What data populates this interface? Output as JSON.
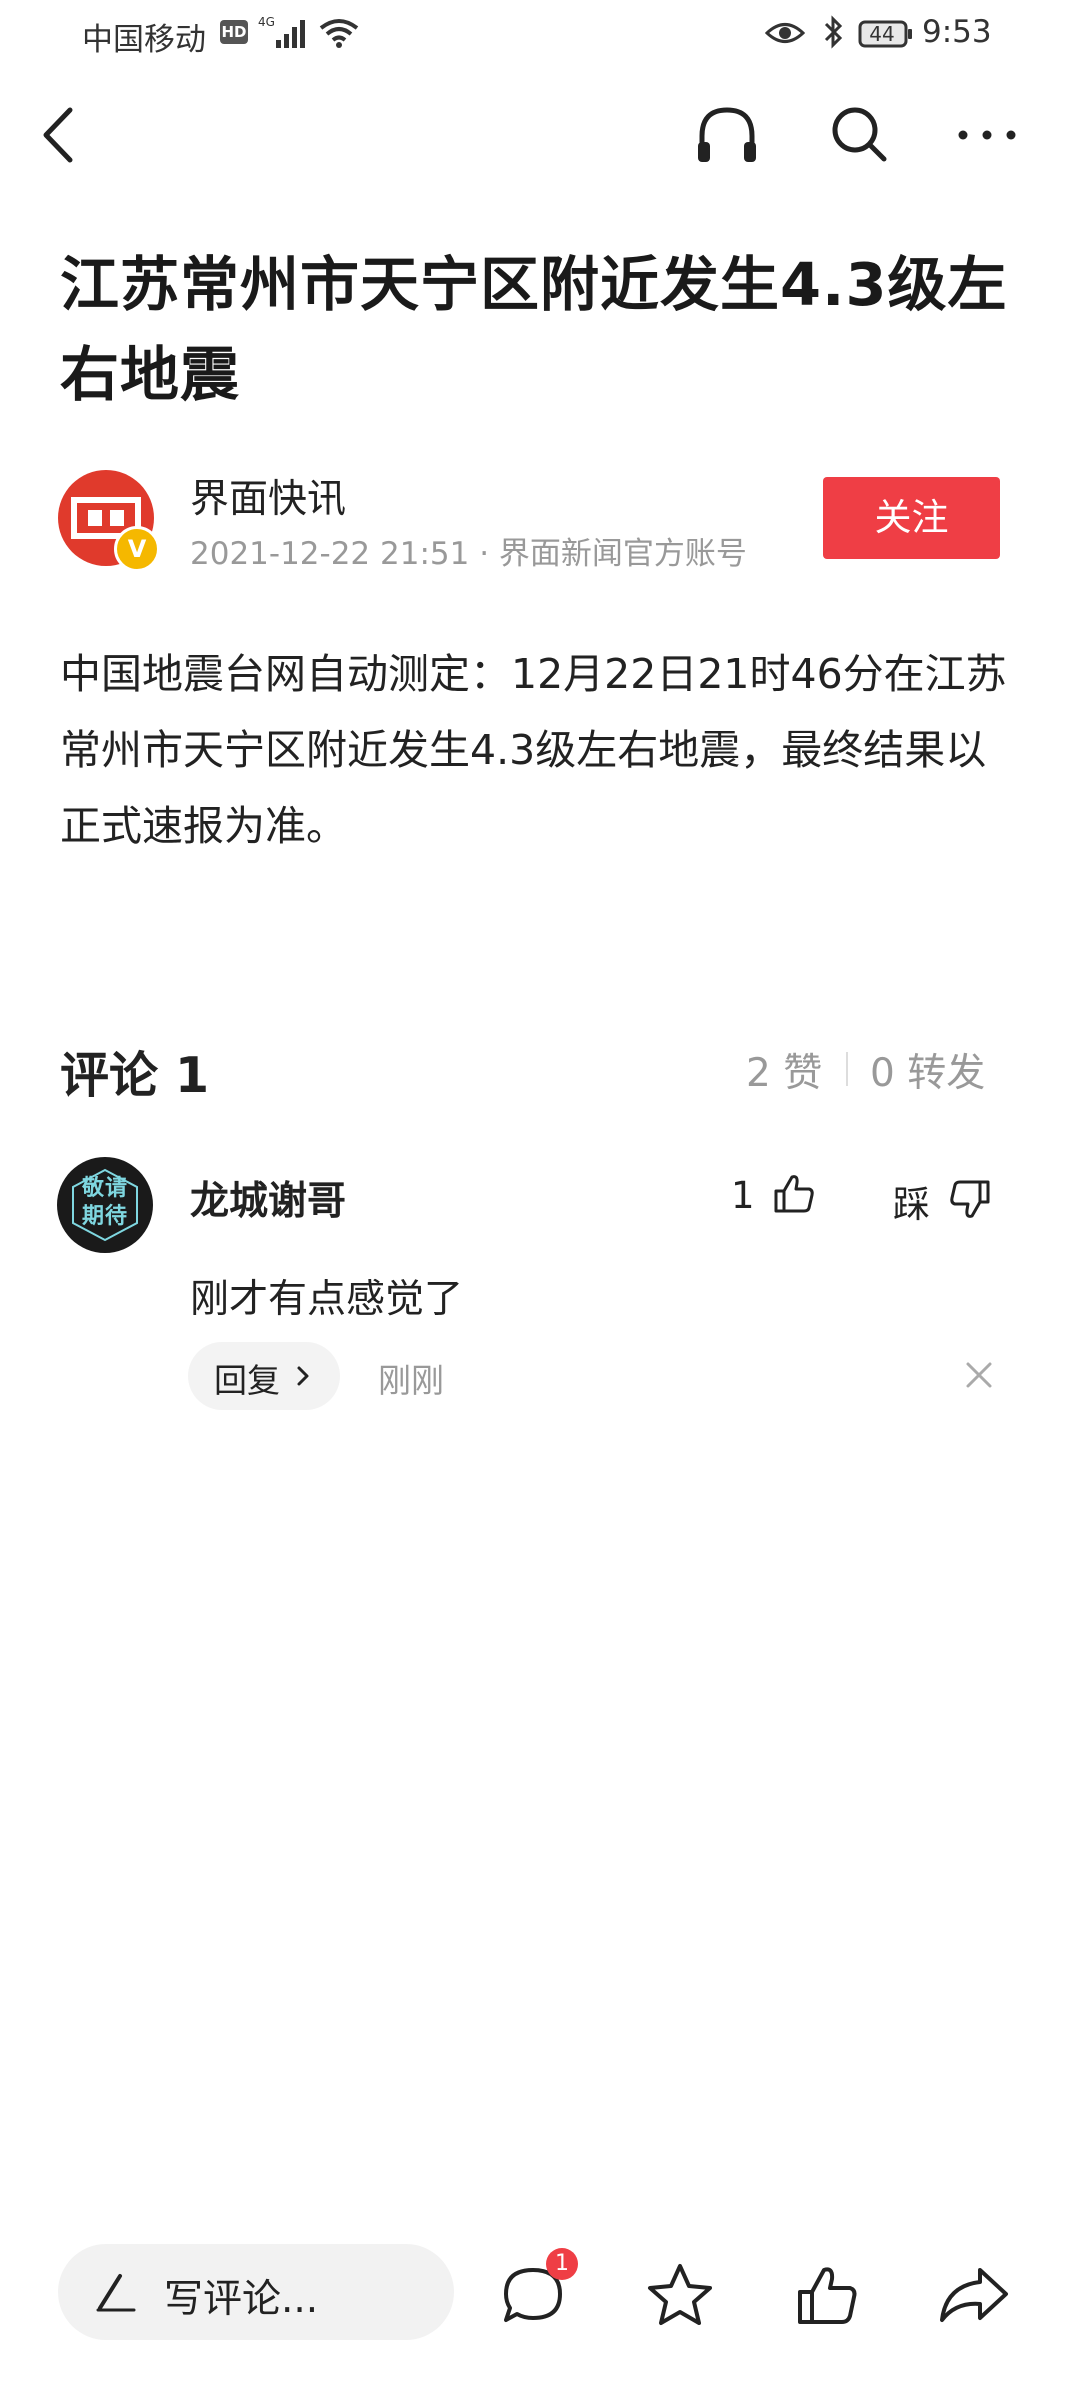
{
  "status_bar": {
    "carrier": "中国移动",
    "hd": "HD",
    "network": "4G",
    "battery": "44",
    "time": "9:53"
  },
  "nav": {
    "icons": [
      "back-icon",
      "headphone-icon",
      "search-icon",
      "more-icon"
    ]
  },
  "article": {
    "title": "江苏常州市天宁区附近发生4.3级左右地震",
    "author": {
      "name": "界面快讯",
      "verified_mark": "V",
      "meta": "2021-12-22 21:51 · 界面新闻官方账号",
      "follow_label": "关注"
    },
    "body": "中国地震台网自动测定：12月22日21时46分在江苏常州市天宁区附近发生4.3级左右地震，最终结果以正式速报为准。"
  },
  "comments": {
    "title": "评论 1",
    "likes": "2 赞",
    "shares": "0 转发",
    "items": [
      {
        "avatar_text": "敬请期待",
        "user": "龙城谢哥",
        "like_count": "1",
        "dislike_label": "踩",
        "text": "刚才有点感觉了",
        "reply_label": "回复",
        "time": "刚刚"
      }
    ]
  },
  "bottom_bar": {
    "write_placeholder": "写评论...",
    "comment_badge": "1",
    "icons": [
      "comment-icon",
      "star-icon",
      "thumb-up-icon",
      "share-icon"
    ]
  },
  "colors": {
    "accent_red": "#ef3e45",
    "text_primary": "#222222",
    "text_secondary": "#999999",
    "verified_gold": "#f5b800"
  }
}
